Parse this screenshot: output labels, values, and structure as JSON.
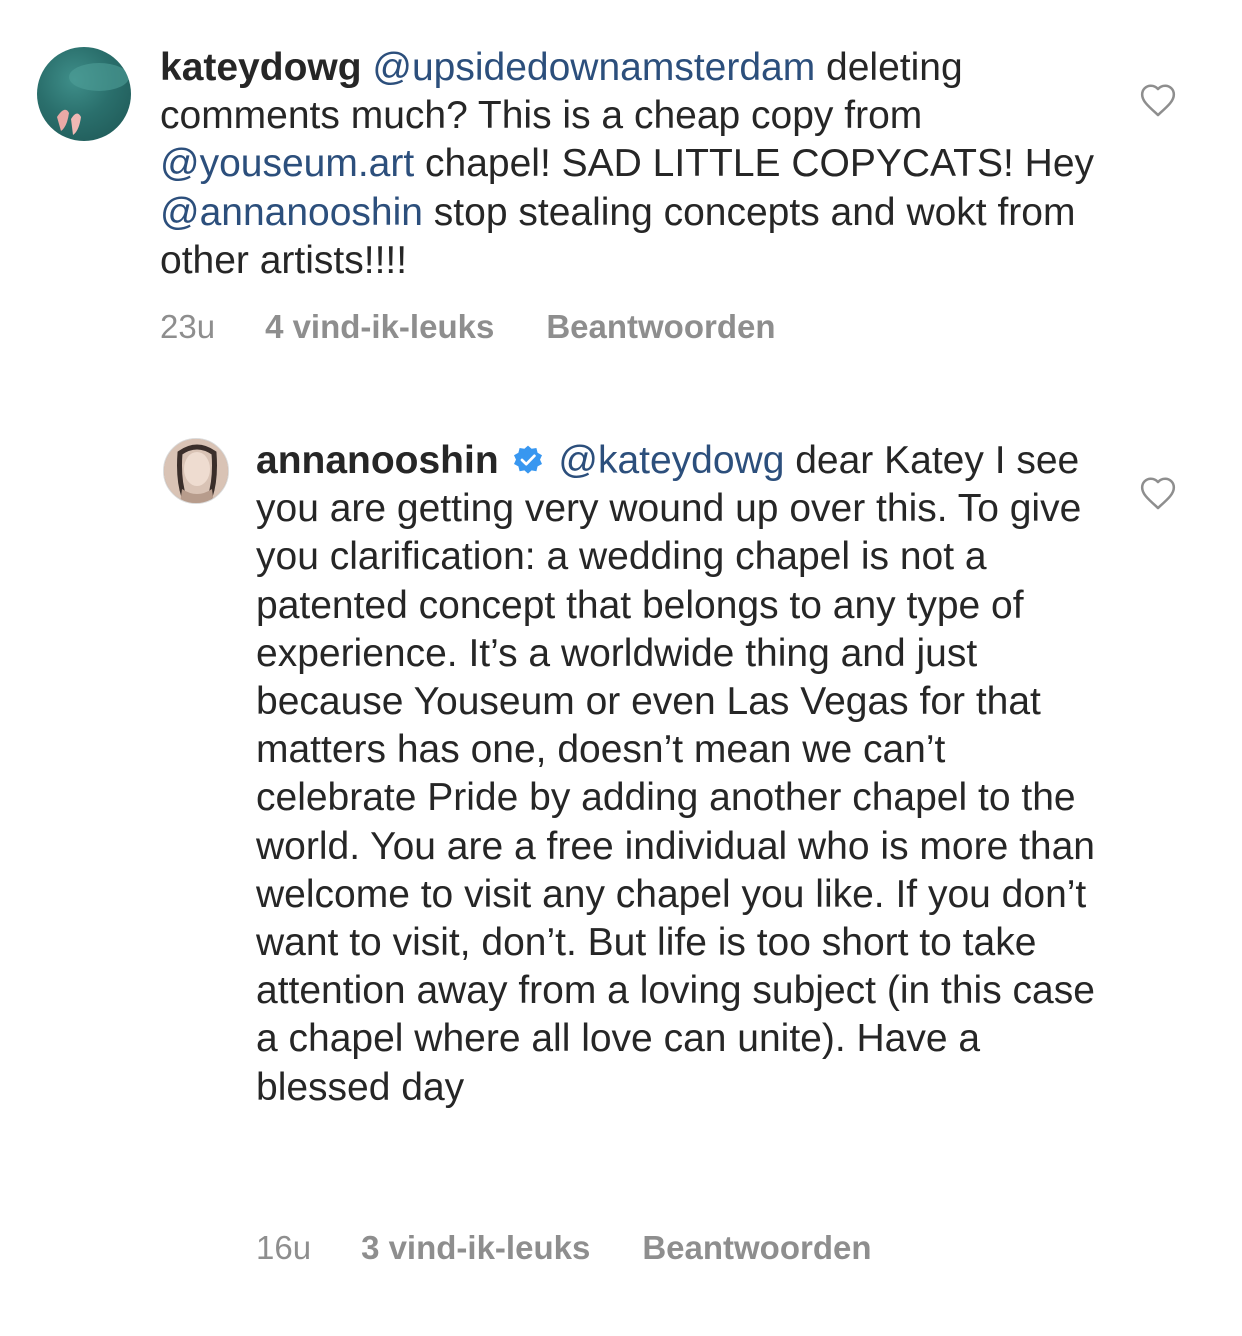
{
  "comments": [
    {
      "username": "kateydowg",
      "segments": [
        {
          "type": "mention",
          "text": "@upsidedownamsterdam"
        },
        {
          "type": "text",
          "text": " deleting comments much? This is a cheap copy from "
        },
        {
          "type": "mention",
          "text": "@youseum.art"
        },
        {
          "type": "text",
          "text": " chapel! SAD LITTLE COPYCATS! Hey "
        },
        {
          "type": "mention",
          "text": "@annanooshin"
        },
        {
          "type": "text",
          "text": " stop stealing concepts and wokt from other artists!!!!"
        }
      ],
      "time": "23u",
      "likes": "4 vind-ik-leuks",
      "reply_label": "Beantwoorden",
      "verified": false,
      "like_icon": "heart-outline-icon"
    },
    {
      "username": "annanooshin",
      "segments": [
        {
          "type": "mention",
          "text": "@kateydowg"
        },
        {
          "type": "text",
          "text": " dear Katey I see you are getting very wound up over this. To give you clarification: a wedding chapel is not a patented concept that belongs to any type of experience. It’s a worldwide thing and just because Youseum or even Las Vegas for that matters has one, doesn’t mean we can’t celebrate Pride by adding another chapel to the world. You are a free individual who is more than welcome to visit any chapel you like. If you don’t want to visit, don’t. But life is too short to take attention away from a loving subject (in this case a chapel where all love can unite). Have a blessed day"
        }
      ],
      "time": "16u",
      "likes": "3 vind-ik-leuks",
      "reply_label": "Beantwoorden",
      "verified": true,
      "like_icon": "heart-outline-icon"
    }
  ],
  "colors": {
    "text": "#262626",
    "mention": "#2c4f7c",
    "meta": "#8e8e8e",
    "verified": "#3897f0"
  }
}
